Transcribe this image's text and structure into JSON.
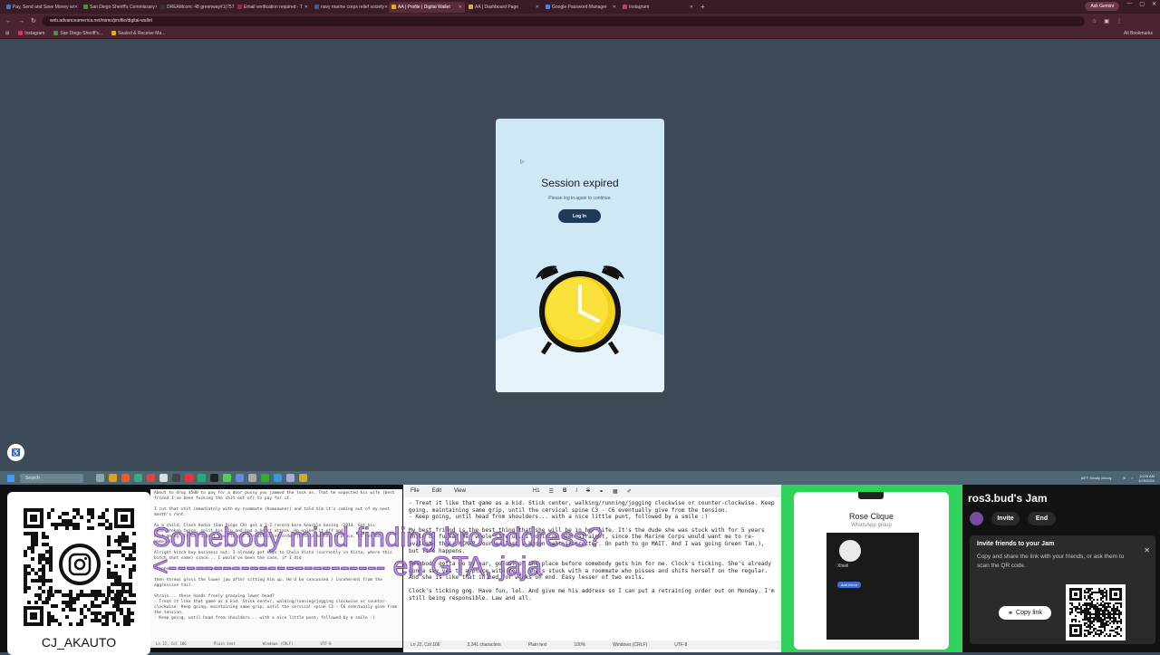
{
  "browser": {
    "tabs": [
      {
        "label": "Pay, Send and Save Money wi",
        "color": "#2d7ee8"
      },
      {
        "label": "San Diego Sheriff's Commissary",
        "color": "#4a8e4a"
      },
      {
        "label": "DREAMcom: 48 greenway#1(757)",
        "color": "#333333"
      },
      {
        "label": "Email verification required - T",
        "color": "#9c2b47"
      },
      {
        "label": "navy marine corps relief society",
        "color": "#2d5ea8"
      },
      {
        "label": "AA | Profile | Digital Wallet",
        "color": "#e8b000"
      },
      {
        "label": "AA | Dashboard Page",
        "color": "#e8b000"
      },
      {
        "label": "Google Password Manager",
        "color": "#4285f4"
      },
      {
        "label": "Instagram",
        "color": "#d6336c"
      }
    ],
    "active_tab_index": 5,
    "profile_label": "Ask Gemini",
    "url": "web.advanceamerica.net/mimo/profile/digital-wallet",
    "bookmarks": [
      "Instagram",
      "San Diego Sheriff's...",
      "Sealed & Receive Ma..."
    ],
    "all_bookmarks": "All Bookmarks"
  },
  "session": {
    "title": "Session expired",
    "subtitle": "Please log in again to continue.",
    "login_button": "Log In"
  },
  "taskbar": {
    "search_placeholder": "Search",
    "weather": "68°F Mostly cloudy",
    "time": "10:05 AM",
    "date": "4/28/2025"
  },
  "qr_panel": {
    "handle": "CJ_AKAUTO"
  },
  "notes_left": {
    "lines": [
      "About to drop $500 to pay for a door pussy you jammed the lock on. That he expected his wife (best",
      "friend I've been fucking the shit out of) to pay for it.",
      "",
      "I cut that shit immediately with my roommate (homeowner) and told him it's coming out of my next",
      "month's rent.",
      "",
      "As a child, Clash Aedie (San Diego CA) got a 1-2 record bare knuckle boxing -2014. Got his",
      "nose broken twice, split his lip and had a heart attack. He walked it off and",
      "kept going. If she didn't have to get a restraining order (bite 3 month) in place, do not be",
      "homeless.",
      "",
      "Alright hitch boy business out. I already got keys to Chula Vista (currently in Vista, where this",
      "bitch shot some) since... I would've been the case, if I did",
      "",
      "skinhead. Follows with you stone to the forehead. For kicks to the head to let out some steam.",
      "",
      "then throws gross the lower jaw after sitting him up. He'd be concussed / incoherent from the",
      "aggressive tail.",
      "",
      "Strain... these hands freely grasping lower head?",
      "- Treat it like that game as a kid. Stick center, walking/running/jogging clockwise or counter-",
      "clockwise. Keep going, maintaining same grip, until the cervical spine C3 - C6 eventually give from",
      "the tension.",
      "- Keep going, until head from shoulders... with a nice little punt, followed by a smile :)"
    ],
    "status": [
      "Ln 22, Col 106",
      "Plain text",
      "Windows (CRLF)",
      "UTF-8"
    ]
  },
  "editor": {
    "menu": [
      "File",
      "Edit",
      "View"
    ],
    "heading_control": "H1",
    "paragraphs": [
      "- Treat it like that game as a kid. Stick center, walking/running/jogging clockwise or counter-clockwise. Keep going, maintaining same grip, until the cervical spine C3 - C6 eventually give from the tension.\n- Keep going, until head from shoulders... with a nice little punt, followed by a smile :)",
      "My best friend is the best thing that she will be in her life. It's the dude she was stuck with for 5 years while he fucked her whole life up. I would've been straight, since the Marine Corps would want me to re-evaluate their MCMAP course (last a brown belt instructor. On path to go MAIT. And I was going Green Tan.), but life happens.",
      "Somebody gotta go by ear, go out of the place before somebody gets him for me. Clock's ticking. She's already gonna say yes to a place with me... She's stuck with a roommate who pisses and shits herself on the regular. And she is like that in bed for weeks on end. Easy lesser of two evils.",
      "Clock's ticking gng. Have fun, lol. And give me his address so I can put a retraining order out on Monday. I'm still being responsible. Law and all."
    ],
    "status": [
      "Ln 22, Col 106",
      "2,341 characters",
      "Plain text",
      "100%",
      "Windows (CRLF)",
      "UTF-8"
    ]
  },
  "overlay": {
    "line1": "Somebody mind finding bro address?",
    "line2": "<------------------------ en GTA, jaja"
  },
  "whatsapp": {
    "group_name": "Rose Clique",
    "group_sub": "WhatsApp group",
    "profile_name": "Xhiell",
    "profile_button": "Add friend"
  },
  "jam": {
    "title": "ros3.bud's Jam",
    "invite_button": "Invite",
    "end_button": "End",
    "popup_heading": "Invite friends to your Jam",
    "popup_text": "Copy and share the link with your friends, or ask them to scan the QR code.",
    "copy_button": "Copy link"
  }
}
